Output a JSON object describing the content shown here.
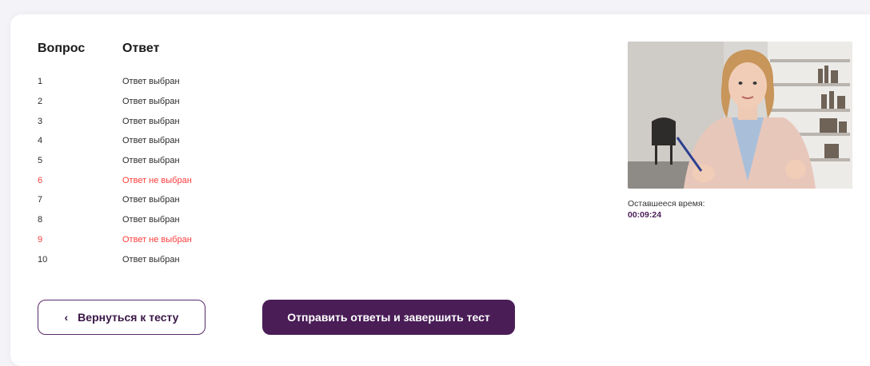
{
  "table": {
    "header_question": "Вопрос",
    "header_answer": "Ответ",
    "rows": [
      {
        "num": "1",
        "status": "Ответ выбран"
      },
      {
        "num": "2",
        "status": "Ответ выбран"
      },
      {
        "num": "3",
        "status": "Ответ выбран"
      },
      {
        "num": "4",
        "status": "Ответ выбран"
      },
      {
        "num": "5",
        "status": "Ответ выбран"
      },
      {
        "num": "6",
        "status": "Ответ не выбран"
      },
      {
        "num": "7",
        "status": "Ответ выбран"
      },
      {
        "num": "8",
        "status": "Ответ выбран"
      },
      {
        "num": "9",
        "status": "Ответ не выбран"
      },
      {
        "num": "10",
        "status": "Ответ выбран"
      }
    ]
  },
  "buttons": {
    "back_label": "Вернуться к тесту",
    "back_icon": "chevron-left-icon",
    "submit_label": "Отправить ответы и завершить тест"
  },
  "timer": {
    "label": "Оставшееся время:",
    "value": "00:09:24"
  },
  "colors": {
    "accent": "#4a1d57",
    "unanswered": "#ff3b3b"
  }
}
